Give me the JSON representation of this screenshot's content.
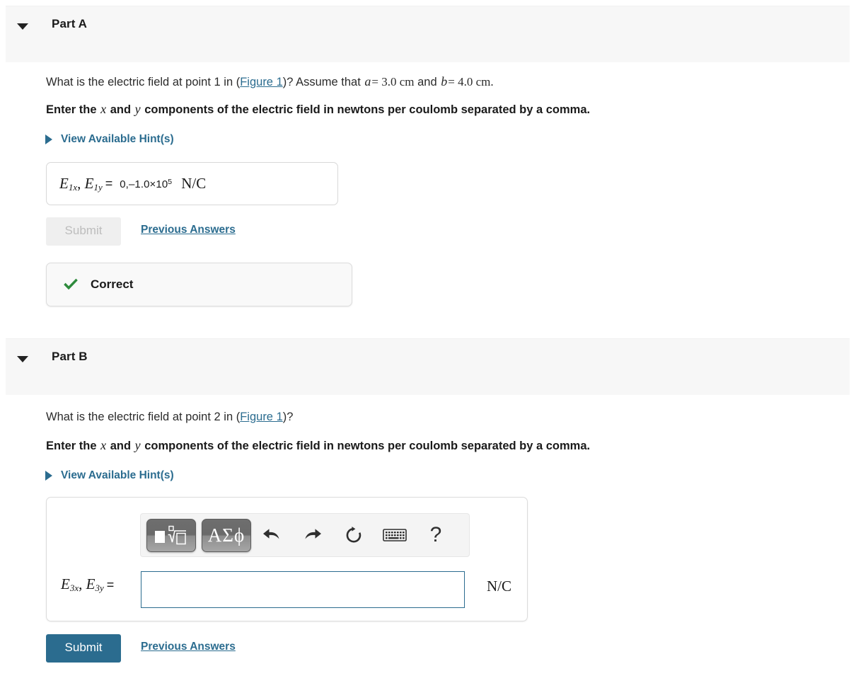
{
  "parts": [
    {
      "id": "a",
      "title": "Part A",
      "caret_icon": "caret-down-icon",
      "question": {
        "prefix": "What is the electric field at point 1 in (",
        "figure_link": "Figure 1",
        "middle": ")? Assume that",
        "var_a": "a",
        "a_value": "= 3.0 cm",
        "and": "and",
        "var_b": "b",
        "b_value": "= 4.0 cm."
      },
      "instruction": {
        "lead": "Enter the",
        "var_x": "x",
        "mid": "and",
        "var_y": "y",
        "tail": "components of the electric field in newtons per coulomb separated by a comma."
      },
      "hints_label": "View Available Hint(s)",
      "hints_icon": "triangle-right-icon",
      "answer": {
        "label_x": "E",
        "label_x_sub": "1x",
        "label_y": "E",
        "label_y_sub": "1y",
        "equals": "=",
        "value_main": "0,–1.0×10",
        "value_exp": "5",
        "unit": "N/C"
      },
      "submit_label": "Submit",
      "submit_enabled": false,
      "previous_answers_label": "Previous Answers",
      "feedback": {
        "icon": "check-mark-icon",
        "label": "Correct",
        "color": "#2e8b3d"
      }
    },
    {
      "id": "b",
      "title": "Part B",
      "caret_icon": "caret-down-icon",
      "question": {
        "prefix": "What is the electric field at point 2 in (",
        "figure_link": "Figure 1",
        "middle": ")?"
      },
      "instruction": {
        "lead": "Enter the",
        "var_x": "x",
        "mid": "and",
        "var_y": "y",
        "tail": "components of the electric field in newtons per coulomb separated by a comma."
      },
      "hints_label": "View Available Hint(s)",
      "hints_icon": "triangle-right-icon",
      "toolbar": {
        "template_button": "template-nth-root-icon",
        "greek_button_label": "ΑΣϕ",
        "undo": "undo-arrow-icon",
        "redo": "redo-arrow-icon",
        "reset": "reset-circular-arrow-icon",
        "keyboard": "keyboard-icon",
        "help": "?"
      },
      "answer": {
        "label_x": "E",
        "label_x_sub": "3x",
        "label_y": "E",
        "label_y_sub": "3y",
        "equals": "=",
        "value": "",
        "placeholder": "",
        "unit": "N/C"
      },
      "submit_label": "Submit",
      "submit_enabled": true,
      "previous_answers_label": "Previous Answers"
    }
  ],
  "colors": {
    "link": "#2b6c8f",
    "primary_button": "#2b6c8f",
    "header_band": "#f7f7f7",
    "correct_green": "#2e8b3d"
  }
}
